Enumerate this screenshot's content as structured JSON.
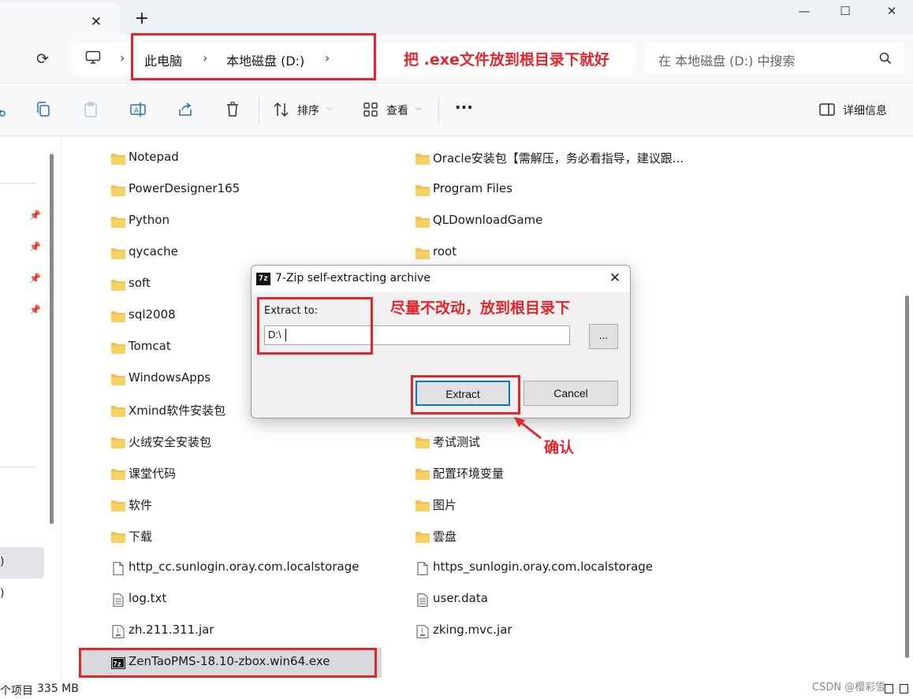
{
  "window": {
    "tab_close": "✕",
    "new_tab": "+",
    "minimize": "—",
    "maximize": "☐",
    "close": "✕"
  },
  "address": {
    "refresh_glyph": "⟳",
    "crumbs": [
      "此电脑",
      "本地磁盘 (D:)"
    ],
    "sep": "›"
  },
  "search": {
    "placeholder": "在 本地磁盘 (D:) 中搜索"
  },
  "toolbar": {
    "sort_label": "排序",
    "view_label": "查看",
    "more_label": "···",
    "details_label": "详细信息",
    "chevron": "⌵"
  },
  "annotations": {
    "top_note": "把 .exe文件放到根目录下就好",
    "dialog_note": "尽量不改动，放到根目录下",
    "confirm_note": "确认"
  },
  "files": {
    "left": [
      {
        "name": "Notepad",
        "type": "folder"
      },
      {
        "name": "PowerDesigner165",
        "type": "folder"
      },
      {
        "name": "Python",
        "type": "folder"
      },
      {
        "name": "qycache",
        "type": "folder"
      },
      {
        "name": "soft",
        "type": "folder"
      },
      {
        "name": "sql2008",
        "type": "folder"
      },
      {
        "name": "Tomcat",
        "type": "folder"
      },
      {
        "name": "WindowsApps",
        "type": "folder"
      },
      {
        "name": "Xmind软件安装包",
        "type": "folder"
      },
      {
        "name": "火绒安全安装包",
        "type": "folder"
      },
      {
        "name": "课堂代码",
        "type": "folder"
      },
      {
        "name": "软件",
        "type": "folder"
      },
      {
        "name": "下载",
        "type": "folder"
      },
      {
        "name": "http_cc.sunlogin.oray.com.localstorage",
        "type": "file"
      },
      {
        "name": "log.txt",
        "type": "text"
      },
      {
        "name": "zh.211.311.jar",
        "type": "jar"
      },
      {
        "name": "ZenTaoPMS-18.10-zbox.win64.exe",
        "type": "7z"
      }
    ],
    "right": [
      {
        "name": "Oracle安装包【需解压，务必看指导，建议跟...",
        "type": "folder"
      },
      {
        "name": "Program Files",
        "type": "folder"
      },
      {
        "name": "QLDownloadGame",
        "type": "folder"
      },
      {
        "name": "root",
        "type": "folder"
      },
      {
        "name": "考试测试",
        "type": "folder"
      },
      {
        "name": "配置环境变量",
        "type": "folder"
      },
      {
        "name": "图片",
        "type": "folder"
      },
      {
        "name": "雲盘",
        "type": "folder"
      },
      {
        "name": "https_sunlogin.oray.com.localstorage",
        "type": "file"
      },
      {
        "name": "user.data",
        "type": "text"
      },
      {
        "name": "zking.mvc.jar",
        "type": "jar"
      }
    ]
  },
  "nav": {
    "frag1": ")",
    "frag2": ")",
    "pin_glyph": "📌"
  },
  "dialog": {
    "icon_text": "7z",
    "title": "7-Zip self-extracting archive",
    "close": "✕",
    "extract_to_label": "Extract to:",
    "path_value": "D:\\",
    "browse_label": "...",
    "extract_button": "Extract",
    "cancel_button": "Cancel"
  },
  "status": {
    "item_count": "个项目",
    "size": "335 MB"
  },
  "watermark": "CSDN @樱彩雪",
  "colors": {
    "accent_red": "#e2262e",
    "folder_yellow": "#f2c14e",
    "button_focus": "#0078d7"
  }
}
